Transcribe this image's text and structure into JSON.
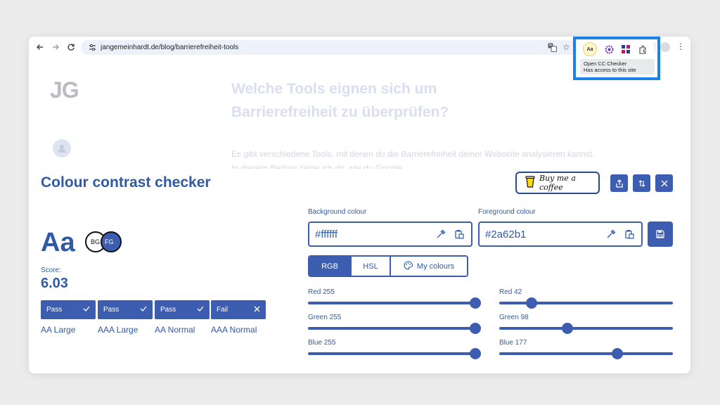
{
  "browser": {
    "url": "jangemeinhardt.de/blog/barrierefreiheit-tools",
    "tooltip_title": "Open CC Checker",
    "tooltip_sub": "Has access to this site",
    "ext_badge": "Aa"
  },
  "page": {
    "logo": "JG",
    "hero_title_1": "Welche Tools eignen sich um",
    "hero_title_2": "Barrierefreiheit zu überprüfen?",
    "hero_text": "Es gibt verschiedene Tools, mit denen du die Barrierefreiheit deiner Webseite analysieren kannst. In diesem Beitrag zeige ich dir, wie du Google"
  },
  "panel": {
    "title": "Colour contrast checker",
    "coffee_label": "Buy me a coffee",
    "preview_text": "Aa",
    "bg_badge": "BG",
    "fg_badge": "FG",
    "score_label": "Score:",
    "score_value": "6.03",
    "results": [
      {
        "status": "Pass",
        "level": "AA Large",
        "pass": true
      },
      {
        "status": "Pass",
        "level": "AAA Large",
        "pass": true
      },
      {
        "status": "Pass",
        "level": "AA Normal",
        "pass": true
      },
      {
        "status": "Fail",
        "level": "AAA Normal",
        "pass": false
      }
    ],
    "background_label": "Background colour",
    "background_value": "#ffffff",
    "foreground_label": "Foreground colour",
    "foreground_value": "#2a62b1",
    "tabs": [
      "RGB",
      "HSL",
      "My colours"
    ],
    "active_tab": "RGB",
    "sliders_bg": [
      {
        "label": "Red 255",
        "value": 255
      },
      {
        "label": "Green 255",
        "value": 255
      },
      {
        "label": "Blue 255",
        "value": 255
      }
    ],
    "sliders_fg": [
      {
        "label": "Red 42",
        "value": 42
      },
      {
        "label": "Green 98",
        "value": 98
      },
      {
        "label": "Blue 177",
        "value": 177
      }
    ]
  },
  "colors": {
    "accent": "#3d5eb0",
    "title": "#2f5aa6",
    "highlight": "#1a82e8"
  }
}
